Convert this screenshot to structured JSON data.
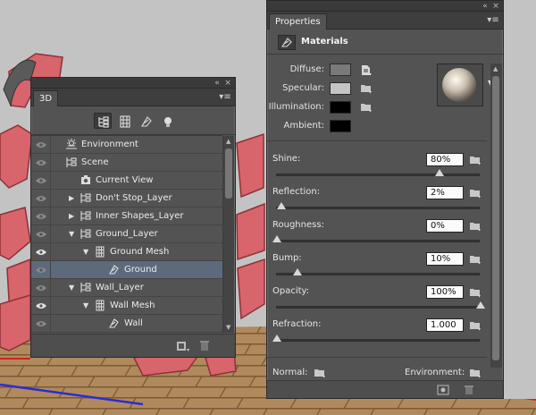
{
  "panel_3d": {
    "tab": "3D",
    "filters": [
      "whole-scene",
      "meshes",
      "materials",
      "lights"
    ],
    "tree": [
      {
        "label": "Environment",
        "icon": "environment-icon",
        "level": 0,
        "arrow": "",
        "eye": false,
        "selected": false
      },
      {
        "label": "Scene",
        "icon": "scene-icon",
        "level": 0,
        "arrow": "",
        "eye": false,
        "selected": false
      },
      {
        "label": "Current View",
        "icon": "camera-icon",
        "level": 1,
        "arrow": "",
        "eye": false,
        "selected": false
      },
      {
        "label": "Don't Stop_Layer",
        "icon": "scene-icon",
        "level": 1,
        "arrow": "right",
        "eye": false,
        "selected": false
      },
      {
        "label": "Inner Shapes_Layer",
        "icon": "scene-icon",
        "level": 1,
        "arrow": "right",
        "eye": false,
        "selected": false
      },
      {
        "label": "Ground_Layer",
        "icon": "scene-icon",
        "level": 1,
        "arrow": "down",
        "eye": false,
        "selected": false
      },
      {
        "label": "Ground Mesh",
        "icon": "mesh-icon",
        "level": 2,
        "arrow": "down",
        "eye": true,
        "selected": false
      },
      {
        "label": "Ground",
        "icon": "material-icon",
        "level": 3,
        "arrow": "",
        "eye": false,
        "selected": true
      },
      {
        "label": "Wall_Layer",
        "icon": "scene-icon",
        "level": 1,
        "arrow": "down",
        "eye": false,
        "selected": false
      },
      {
        "label": "Wall Mesh",
        "icon": "mesh-icon",
        "level": 2,
        "arrow": "down",
        "eye": true,
        "selected": false
      },
      {
        "label": "Wall",
        "icon": "material-icon",
        "level": 3,
        "arrow": "",
        "eye": false,
        "selected": false
      }
    ]
  },
  "properties": {
    "tab": "Properties",
    "section_title": "Materials",
    "swatches": [
      {
        "label": "Diffuse:",
        "color": "#7a7a7a",
        "folder_icon": "texture-page-icon"
      },
      {
        "label": "Specular:",
        "color": "#c4c4c4",
        "folder_icon": "folder-icon"
      },
      {
        "label": "Illumination:",
        "color": "#000000",
        "folder_icon": "folder-icon"
      },
      {
        "label": "Ambient:",
        "color": "#000000",
        "folder_icon": ""
      }
    ],
    "sliders": [
      {
        "label": "Shine:",
        "value": "80%",
        "level": 0.8
      },
      {
        "label": "Reflection:",
        "value": "2%",
        "level": 0.02
      },
      {
        "label": "Roughness:",
        "value": "0%",
        "level": 0
      },
      {
        "label": "Bump:",
        "value": "10%",
        "level": 0.1
      },
      {
        "label": "Opacity:",
        "value": "100%",
        "level": 1
      },
      {
        "label": "Refraction:",
        "value": "1.000",
        "level": 0
      }
    ],
    "normal_label": "Normal:",
    "environment_label": "Environment:"
  }
}
